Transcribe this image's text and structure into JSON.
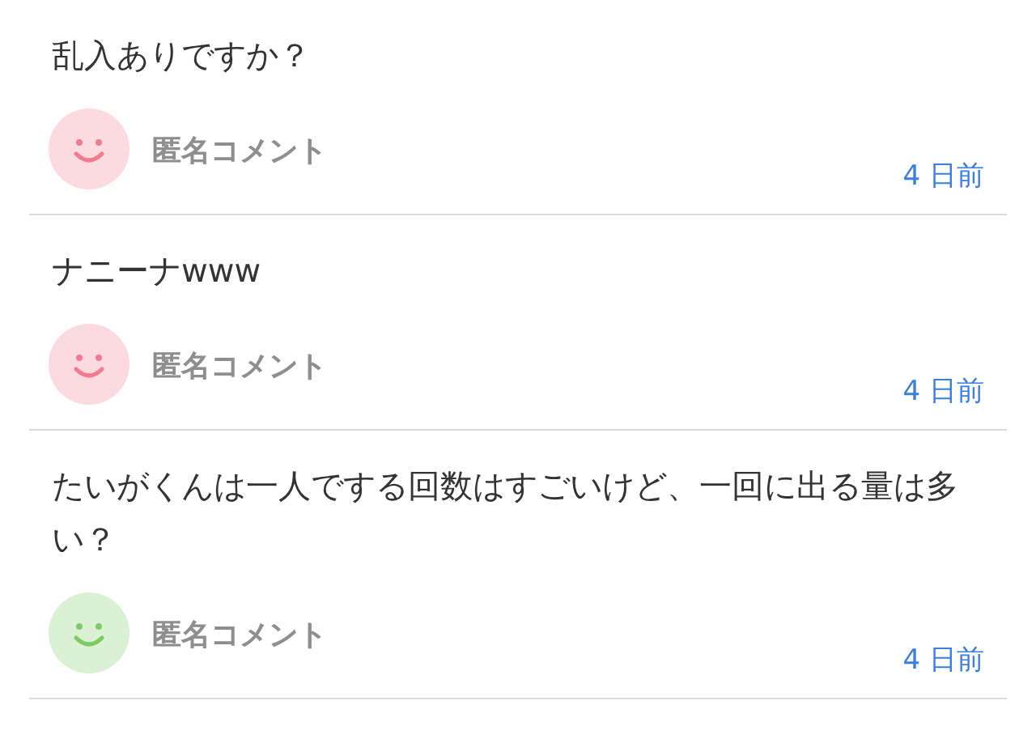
{
  "comments": [
    {
      "text": "乱入ありですか？",
      "author": "匿名コメント",
      "time": "4 日前",
      "color": "#f27c8e"
    },
    {
      "text": "ナニーナwww",
      "author": "匿名コメント",
      "time": "4 日前",
      "color": "#f27c8e"
    },
    {
      "text": "たいがくんは一人でする回数はすごいけど、一回に出る量は多い？",
      "author": "匿名コメント",
      "time": "4 日前",
      "color": "#7ccb63"
    }
  ]
}
